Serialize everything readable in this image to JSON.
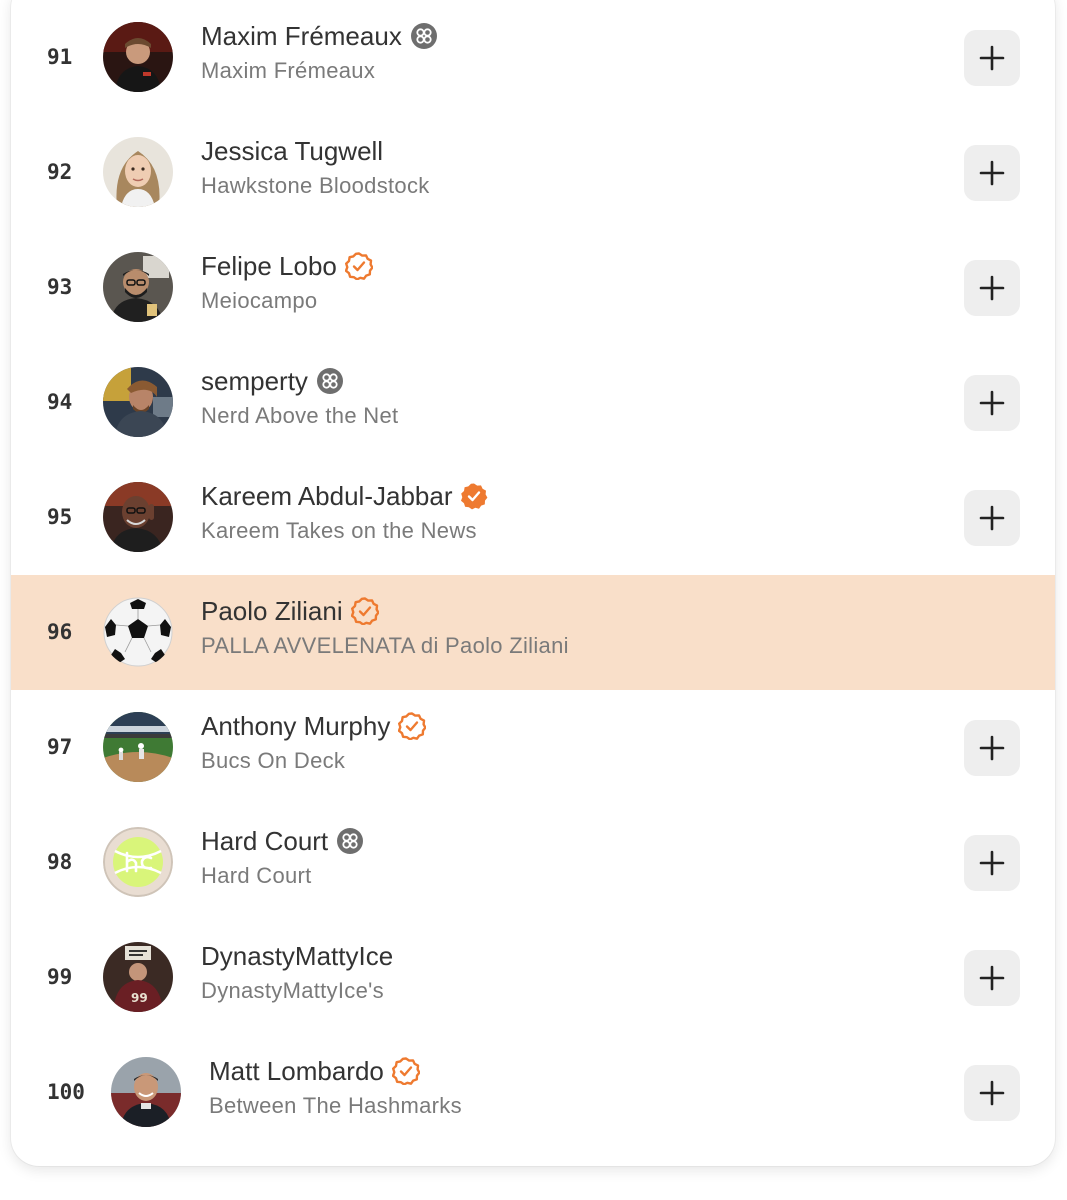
{
  "colors": {
    "accent": "#ee7a30",
    "highlight_row": "#f9dfc9",
    "button_bg": "#eeeeee",
    "text_primary": "#333333",
    "text_secondary": "#7a7a7a",
    "bestseller_badge": "#6e6e6e"
  },
  "leaderboard": {
    "rows": [
      {
        "rank": "91",
        "name": "Maxim Frémeaux",
        "publication": "Maxim Frémeaux",
        "badge": "bestseller-icon",
        "highlighted": false,
        "avatar": "photo"
      },
      {
        "rank": "92",
        "name": "Jessica Tugwell",
        "publication": "Hawkstone Bloodstock",
        "badge": "",
        "highlighted": false,
        "avatar": "photo"
      },
      {
        "rank": "93",
        "name": "Felipe Lobo",
        "publication": "Meiocampo",
        "badge": "verified-outline-icon",
        "highlighted": false,
        "avatar": "photo"
      },
      {
        "rank": "94",
        "name": "semperty",
        "publication": "Nerd Above the Net",
        "badge": "bestseller-icon",
        "highlighted": false,
        "avatar": "photo"
      },
      {
        "rank": "95",
        "name": "Kareem Abdul-Jabbar",
        "publication": "Kareem Takes on the News",
        "badge": "verified-filled-icon",
        "highlighted": false,
        "avatar": "photo"
      },
      {
        "rank": "96",
        "name": "Paolo Ziliani",
        "publication": "PALLA AVVELENATA di Paolo Ziliani",
        "badge": "verified-outline-icon",
        "highlighted": true,
        "avatar": "soccer-ball"
      },
      {
        "rank": "97",
        "name": "Anthony Murphy",
        "publication": "Bucs On Deck",
        "badge": "verified-outline-icon",
        "highlighted": false,
        "avatar": "baseball-field"
      },
      {
        "rank": "98",
        "name": "Hard Court",
        "publication": "Hard Court",
        "badge": "bestseller-icon",
        "highlighted": false,
        "avatar": "tennis-ball-logo"
      },
      {
        "rank": "99",
        "name": "DynastyMattyIce",
        "publication": "DynastyMattyIce's",
        "badge": "",
        "highlighted": false,
        "avatar": "photo"
      },
      {
        "rank": "100",
        "name": "Matt Lombardo",
        "publication": "Between The Hashmarks",
        "badge": "verified-outline-icon",
        "highlighted": false,
        "avatar": "photo"
      }
    ],
    "add_button_icon": "plus-icon"
  }
}
